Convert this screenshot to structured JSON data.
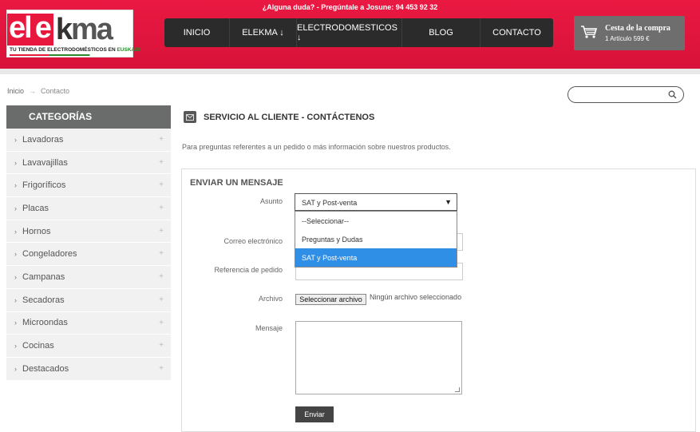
{
  "topbar": {
    "text": "¿Alguna duda? - Pregúntale a Josune:  94 453 92 32"
  },
  "logo": {
    "part1": "el",
    "part2": "e",
    "part3": "k",
    "part4": "ma",
    "tagline": "TU TIENDA DE ELECTRODOMÉSTICOS EN",
    "tagline_region": "EUSKADI"
  },
  "nav": {
    "items": [
      {
        "label": "INICIO"
      },
      {
        "label": "ELEKMA ↓"
      },
      {
        "label": "ELECTRODOMESTICOS ↓"
      },
      {
        "label": "BLOG"
      },
      {
        "label": "CONTACTO"
      }
    ]
  },
  "cart": {
    "title": "Cesta de la compra",
    "summary": "1 Artículo 599 €"
  },
  "breadcrumb": {
    "home": "Inicio",
    "separator": "→",
    "current": "Contacto"
  },
  "search": {
    "placeholder": "",
    "value": ""
  },
  "sidebar": {
    "title": "CATEGORÍAS",
    "items": [
      {
        "label": "Lavadoras"
      },
      {
        "label": "Lavavajillas"
      },
      {
        "label": "Frigoríficos"
      },
      {
        "label": "Placas"
      },
      {
        "label": "Hornos"
      },
      {
        "label": "Congeladores"
      },
      {
        "label": "Campanas"
      },
      {
        "label": "Secadoras"
      },
      {
        "label": "Microondas"
      },
      {
        "label": "Cocinas"
      },
      {
        "label": "Destacados"
      }
    ]
  },
  "main": {
    "title": "SERVICIO AL CLIENTE - CONTÁCTENOS",
    "intro": "Para preguntas referentes a un pedido o más información sobre nuestros productos.",
    "form": {
      "title": "ENVIAR UN MENSAJE",
      "subject_label": "Asunto",
      "subject_value": "SAT y Post-venta",
      "subject_options": [
        "--Seleccionar--",
        "Preguntas y Dudas",
        "SAT y Post-venta"
      ],
      "email_label": "Correo electrónico",
      "order_label": "Referencia de pedido",
      "file_label": "Archivo",
      "file_button": "Seleccionar archivo",
      "file_status": "Ningún archivo seleccionado",
      "message_label": "Mensaje",
      "send_label": "Enviar"
    }
  },
  "colors": {
    "brand_red": "#e8173e",
    "nav_dark": "#2b2b2b",
    "selected_option": "#2f8ee5"
  }
}
